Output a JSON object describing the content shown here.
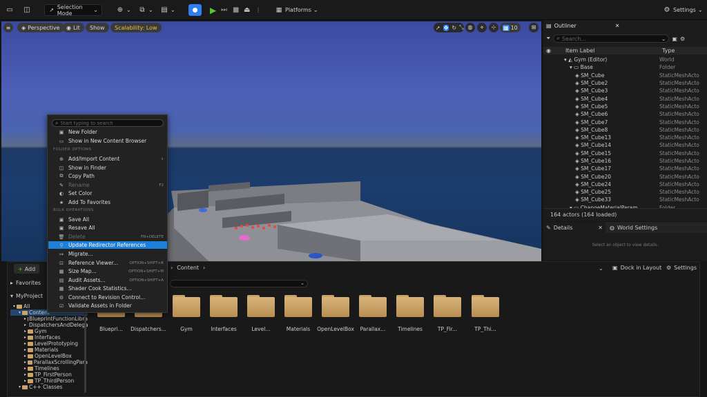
{
  "toolbar": {
    "selection_mode": "Selection Mode",
    "platforms": "Platforms",
    "settings": "Settings"
  },
  "viewport": {
    "perspective": "Perspective",
    "lit": "Lit",
    "show": "Show",
    "scalability": "Scalability: Low",
    "grid_value": "10"
  },
  "outliner": {
    "tab": "Outliner",
    "search_placeholder": "Search...",
    "col_label": "Item Label",
    "col_type": "Type",
    "rows": [
      {
        "label": "Gym (Editor)",
        "type": "World",
        "indent": 0
      },
      {
        "label": "Base",
        "type": "Folder",
        "indent": 1
      },
      {
        "label": "SM_Cube",
        "type": "StaticMeshActo",
        "indent": 2
      },
      {
        "label": "SM_Cube2",
        "type": "StaticMeshActo",
        "indent": 2
      },
      {
        "label": "SM_Cube3",
        "type": "StaticMeshActo",
        "indent": 2
      },
      {
        "label": "SM_Cube4",
        "type": "StaticMeshActo",
        "indent": 2
      },
      {
        "label": "SM_Cube5",
        "type": "StaticMeshActo",
        "indent": 2
      },
      {
        "label": "SM_Cube6",
        "type": "StaticMeshActo",
        "indent": 2
      },
      {
        "label": "SM_Cube7",
        "type": "StaticMeshActo",
        "indent": 2
      },
      {
        "label": "SM_Cube8",
        "type": "StaticMeshActo",
        "indent": 2
      },
      {
        "label": "SM_Cube13",
        "type": "StaticMeshActo",
        "indent": 2
      },
      {
        "label": "SM_Cube14",
        "type": "StaticMeshActo",
        "indent": 2
      },
      {
        "label": "SM_Cube15",
        "type": "StaticMeshActo",
        "indent": 2
      },
      {
        "label": "SM_Cube16",
        "type": "StaticMeshActo",
        "indent": 2
      },
      {
        "label": "SM_Cube17",
        "type": "StaticMeshActo",
        "indent": 2
      },
      {
        "label": "SM_Cube20",
        "type": "StaticMeshActo",
        "indent": 2
      },
      {
        "label": "SM_Cube24",
        "type": "StaticMeshActo",
        "indent": 2
      },
      {
        "label": "SM_Cube25",
        "type": "StaticMeshActo",
        "indent": 2
      },
      {
        "label": "SM_Cube33",
        "type": "StaticMeshActo",
        "indent": 2
      },
      {
        "label": "ChangeMaterialParam",
        "type": "Folder",
        "indent": 1
      }
    ],
    "status": "164 actors (164 loaded)"
  },
  "details": {
    "tab": "Details",
    "world_tab": "World Settings",
    "empty": "Select an object to view details."
  },
  "content_browser": {
    "add": "Add",
    "favorites": "Favorites",
    "project": "MyProject",
    "path_content": "Content",
    "dock": "Dock in Layout",
    "settings": "Settings",
    "tree": [
      {
        "label": "All",
        "indent": 0
      },
      {
        "label": "Content",
        "indent": 1
      },
      {
        "label": "BlueprintFunctionLibra",
        "indent": 2
      },
      {
        "label": "DispatchersAndDelega",
        "indent": 2
      },
      {
        "label": "Gym",
        "indent": 2
      },
      {
        "label": "Interfaces",
        "indent": 2
      },
      {
        "label": "LevelPrototyping",
        "indent": 2
      },
      {
        "label": "Materials",
        "indent": 2
      },
      {
        "label": "OpenLevelBox",
        "indent": 2
      },
      {
        "label": "ParallaxScrollingPara",
        "indent": 2
      },
      {
        "label": "Timelines",
        "indent": 2
      },
      {
        "label": "TP_FirstPerson",
        "indent": 2
      },
      {
        "label": "TP_ThirdPerson",
        "indent": 2
      },
      {
        "label": "C++ Classes",
        "indent": 1
      }
    ],
    "folders": [
      "Bluepri...",
      "Dispatchers...",
      "Gym",
      "Interfaces",
      "Level...",
      "Materials",
      "OpenLevelBox",
      "Parallax...",
      "Timelines",
      "TP_Fir...",
      "TP_Thi..."
    ]
  },
  "context_menu": {
    "search_placeholder": "Start typing to search",
    "folder_options": "FOLDER OPTIONS",
    "bulk_operations": "BULK OPERATIONS",
    "items": [
      {
        "label": "New Folder",
        "shortcut": ""
      },
      {
        "label": "Show in New Content Browser",
        "shortcut": ""
      },
      {
        "label": "Add/Import Content",
        "shortcut": ""
      },
      {
        "label": "Show in Finder",
        "shortcut": ""
      },
      {
        "label": "Copy Path",
        "shortcut": ""
      },
      {
        "label": "Rename",
        "shortcut": "F2"
      },
      {
        "label": "Set Color",
        "shortcut": ""
      },
      {
        "label": "Add To Favorites",
        "shortcut": ""
      },
      {
        "label": "Save All",
        "shortcut": ""
      },
      {
        "label": "Resave All",
        "shortcut": ""
      },
      {
        "label": "Delete",
        "shortcut": "FN+DELETE"
      },
      {
        "label": "Update Redirector References",
        "shortcut": ""
      },
      {
        "label": "Migrate...",
        "shortcut": ""
      },
      {
        "label": "Reference Viewer...",
        "shortcut": "OPTION+SHIFT+R"
      },
      {
        "label": "Size Map...",
        "shortcut": "OPTION+SHIFT+M"
      },
      {
        "label": "Audit Assets...",
        "shortcut": "OPTION+SHIFT+A"
      },
      {
        "label": "Shader Cook Statistics...",
        "shortcut": ""
      },
      {
        "label": "Connect to Revision Control...",
        "shortcut": ""
      },
      {
        "label": "Validate Assets in Folder",
        "shortcut": ""
      }
    ]
  }
}
